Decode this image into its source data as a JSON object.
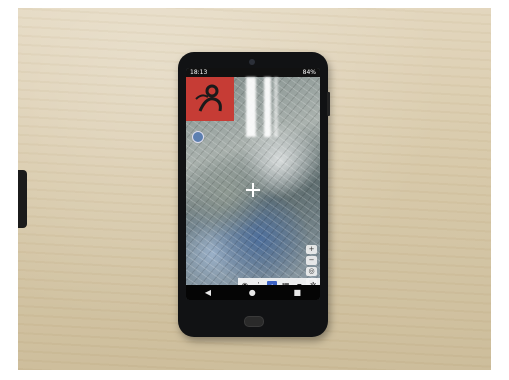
{
  "scene": {
    "background_color": "#d8c9a9",
    "phone_color": "#111214"
  },
  "status_bar": {
    "time": "18:13",
    "battery": "84%"
  },
  "map_app": {
    "toolbar_icons": [
      "camera-icon",
      "route-icon",
      "share-icon",
      "layers-icon",
      "pin-icon",
      "menu-icon"
    ],
    "side_control_icons": [
      "zoom-in-icon",
      "zoom-out-icon",
      "locate-icon",
      "layers-icon"
    ]
  },
  "nav_bar": {
    "back": "◀",
    "home": "●",
    "recents": "■"
  }
}
